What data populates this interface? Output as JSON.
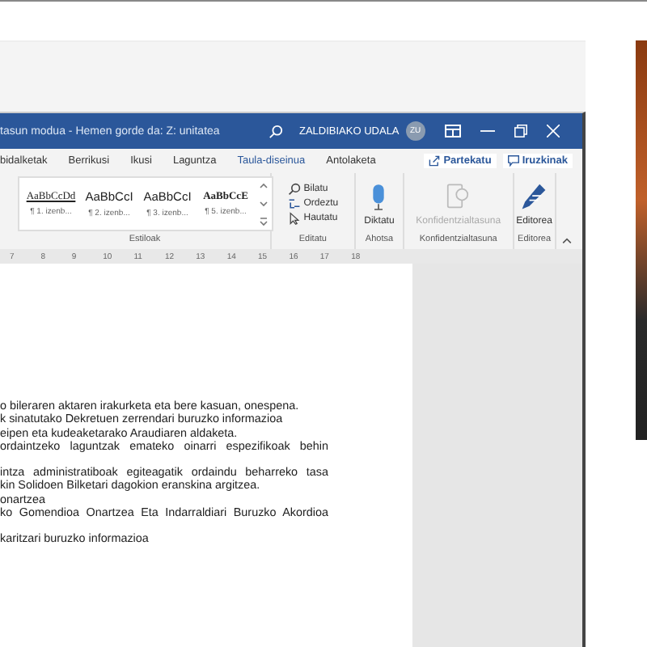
{
  "window": {
    "title": "tasun modua - Hemen gorde da: Z: unitatea",
    "user": "ZALDIBIAKO UDALA",
    "avatar": "ZU"
  },
  "tabs": [
    {
      "label": "bidalketak",
      "contextual": false
    },
    {
      "label": "Berrikusi",
      "contextual": false
    },
    {
      "label": "Ikusi",
      "contextual": false
    },
    {
      "label": "Laguntza",
      "contextual": false
    },
    {
      "label": "Taula-diseinua",
      "contextual": true
    },
    {
      "label": "Antolaketa",
      "contextual": false
    }
  ],
  "actions": [
    {
      "kind": "share",
      "label": "Partekatu"
    },
    {
      "kind": "comments",
      "label": "Iruzkinak"
    }
  ],
  "ribbon": [
    {
      "kind": "styles",
      "label": "Estiloak",
      "styles": [
        {
          "sample": "AaBbCcDd",
          "name": "¶ 1. izenb..."
        },
        {
          "sample": "AaBbCcI",
          "name": "¶ 2. izenb..."
        },
        {
          "sample": "AaBbCcI",
          "name": "¶ 3. izenb..."
        },
        {
          "sample": "AaBbCcE",
          "name": "¶ 5. izenb..."
        }
      ]
    },
    {
      "kind": "editing",
      "label": "Editatu",
      "items": [
        "Bilatu",
        "Ordeztu",
        "Hautatu"
      ]
    },
    {
      "kind": "dictate",
      "label": "Ahotsa",
      "button": "Diktatu",
      "disabled": false
    },
    {
      "kind": "sensitivity",
      "label": "Konfidentzialtasuna",
      "button": "Konfidentzialtasuna",
      "disabled": true
    },
    {
      "kind": "editor",
      "label": "Editorea",
      "button": "Editorea",
      "disabled": false
    }
  ],
  "ruler": [
    "7",
    "8",
    "9",
    "10",
    "11",
    "12",
    "13",
    "14",
    "15",
    "16",
    "17",
    "18"
  ],
  "document": {
    "paragraphs": [
      {
        "lines": [
          {
            "text": "o bileraren aktaren irakurketa eta bere kasuan, onespena.",
            "justified": false
          },
          {
            "text": "k sinatutako Dekretuen zerrendari buruzko informazioa",
            "justified": false
          },
          {
            "text": "eipen eta kudeaketarako Araudiaren aldaketa.",
            "justified": false
          },
          {
            "text": "ordaintzeko laguntzak emateko oinarri espezifikoak behin",
            "justified": true
          }
        ]
      },
      {
        "lines": [
          {
            "text": "intza administratiboak egiteagatik ordaindu beharreko tasa",
            "justified": true
          },
          {
            "text": "kin Solidoen Bilketari dagokion eranskina argitzea.",
            "justified": false
          },
          {
            "text": "onartzea",
            "justified": false
          },
          {
            "text": "ko Gomendioa Onartzea Eta Indarraldiari Buruzko Akordioa",
            "justified": true
          }
        ]
      },
      {
        "lines": [
          {
            "text": "karitzari buruzko informazioa",
            "justified": false
          }
        ]
      }
    ]
  }
}
